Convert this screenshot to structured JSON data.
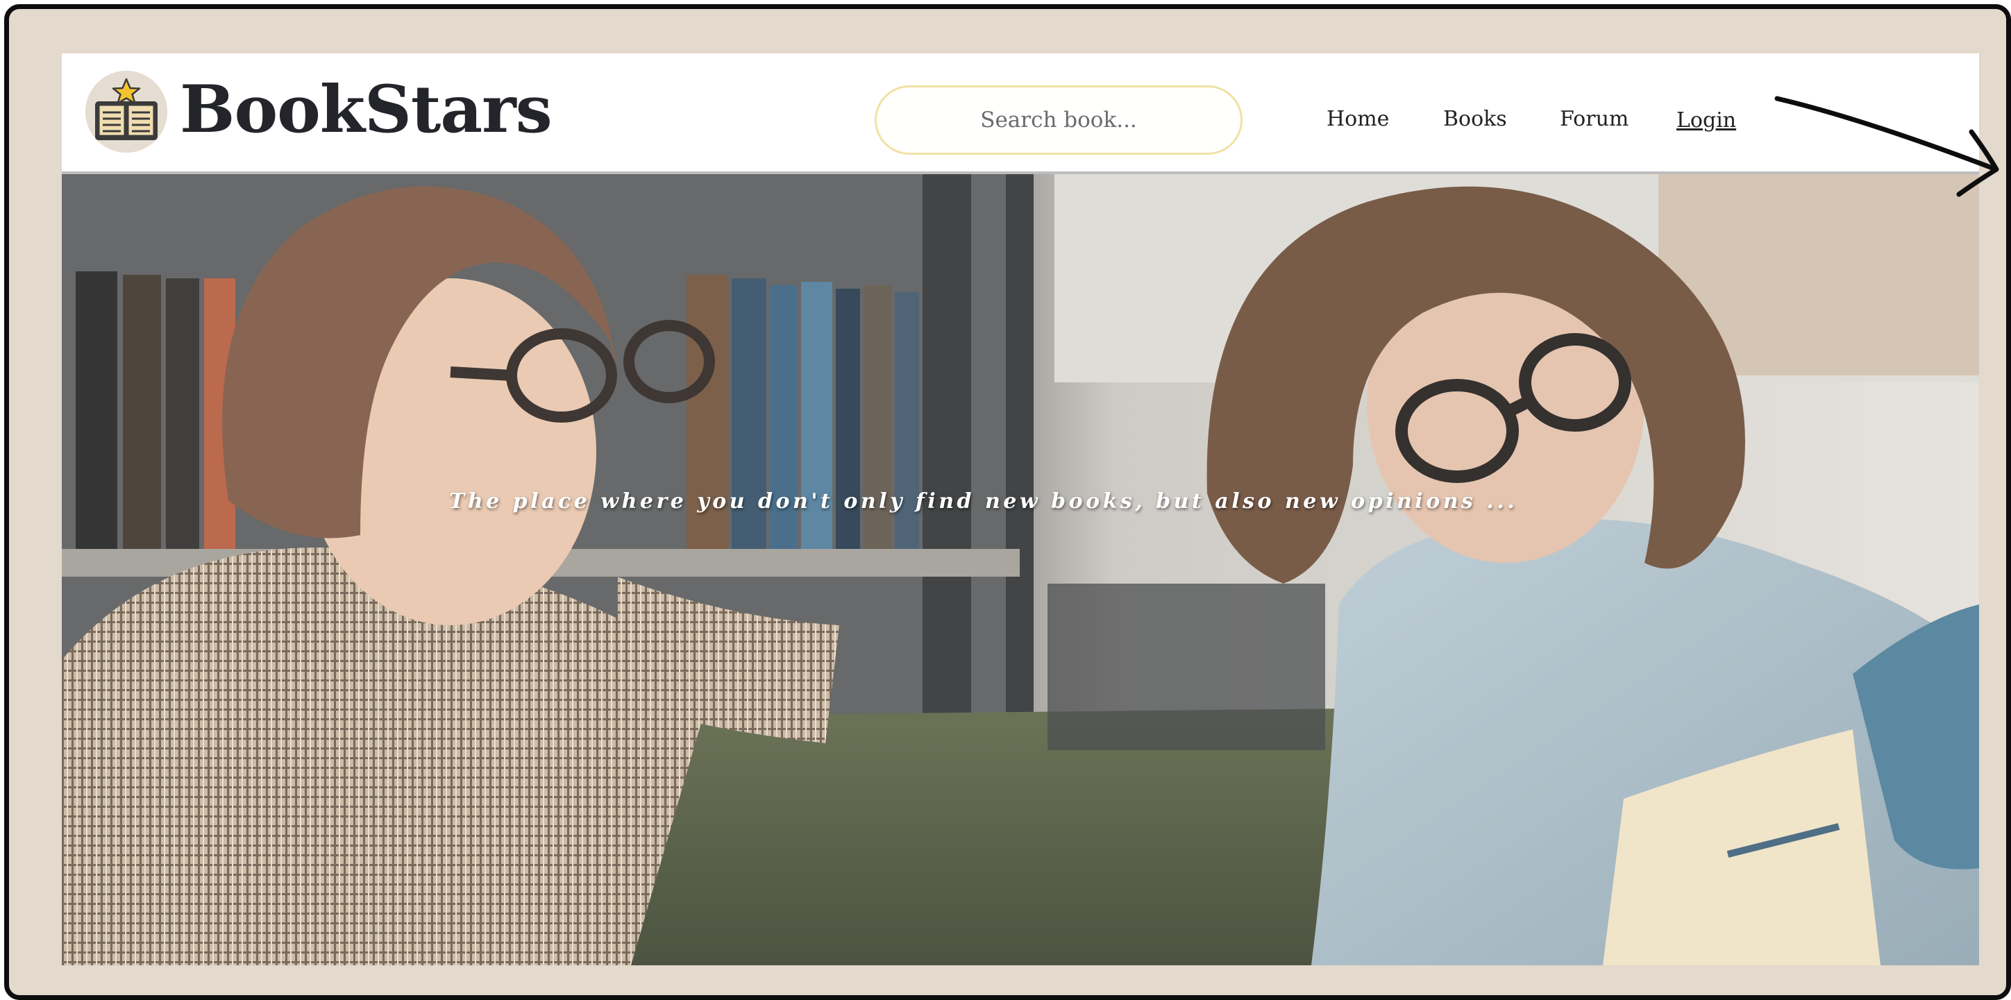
{
  "brand": {
    "name": "BookStars",
    "logo_icon": "book-star-icon"
  },
  "search": {
    "placeholder": "Search book..."
  },
  "nav": {
    "home": "Home",
    "books": "Books",
    "forum": "Forum",
    "login": "Login"
  },
  "hero": {
    "tagline": "The place where you don't only find new books, but also new opinions ..."
  },
  "colors": {
    "frame_background": "#e3d9cc",
    "frame_border": "#0d0d0d",
    "search_border": "#f1e2a4",
    "brand_text": "#23252a"
  },
  "annotation": {
    "arrow_icon": "hand-drawn-arrow-icon"
  }
}
